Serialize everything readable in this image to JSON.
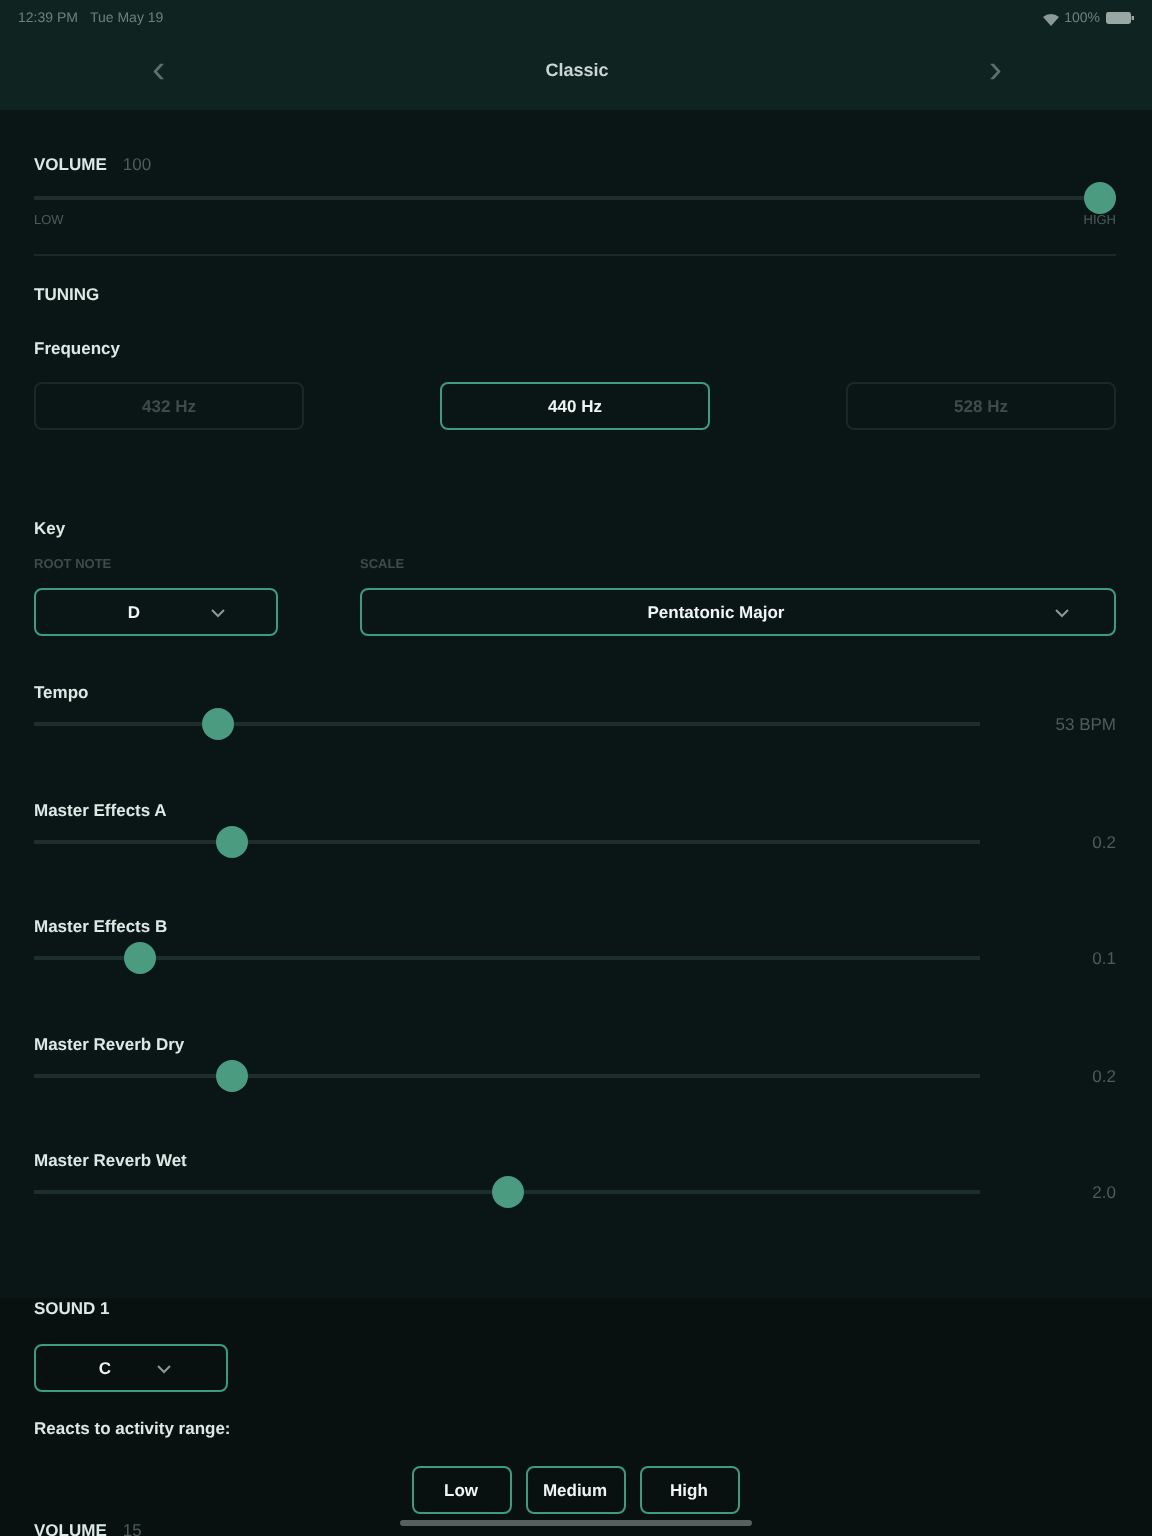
{
  "status_bar": {
    "time": "12:39 PM",
    "date": "Tue May 19",
    "battery": "100%"
  },
  "nav": {
    "title": "Classic",
    "back": "‹",
    "forward": "›"
  },
  "volume": {
    "label": "VOLUME",
    "value": "100",
    "level": 1,
    "low": "LOW",
    "high": "HIGH"
  },
  "tuning": {
    "title": "TUNING",
    "frequency_label": "Frequency",
    "frequencies": [
      {
        "label": "432 Hz",
        "selected": false
      },
      {
        "label": "440 Hz",
        "selected": true
      },
      {
        "label": "528 Hz",
        "selected": false
      }
    ]
  },
  "key": {
    "title": "Key",
    "root_label": "ROOT NOTE",
    "root_value": "D",
    "scale_label": "SCALE",
    "scale_value": "Pentatonic Major"
  },
  "sliders": [
    {
      "name": "Tempo",
      "level": 0.195,
      "reading": "53 BPM"
    },
    {
      "name": "Master Effects A",
      "level": 0.21,
      "reading": "0.2"
    },
    {
      "name": "Master Effects B",
      "level": 0.112,
      "reading": "0.1"
    },
    {
      "name": "Master Reverb Dry",
      "level": 0.21,
      "reading": "0.2"
    },
    {
      "name": "Master Reverb Wet",
      "level": 0.5,
      "reading": "2.0"
    }
  ],
  "sound": {
    "title": "SOUND 1",
    "note": "C",
    "activity_label": "Reacts to activity range:",
    "ranges": [
      "Low",
      "Medium",
      "High"
    ],
    "volume_label": "VOLUME",
    "volume_value": "15"
  }
}
